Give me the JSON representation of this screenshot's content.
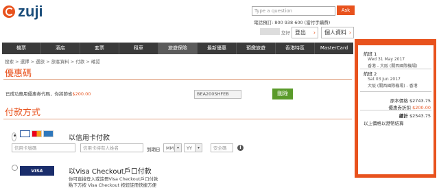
{
  "brand": {
    "name": "zuji",
    "accent": "#e8521d",
    "logo_color": "#1a4d7a"
  },
  "header": {
    "search_placeholder": "Type a question",
    "ask_label": "Ask",
    "phone": "電話預訂: 800 938 600 (當付手續費)",
    "account_time": "您好",
    "logout_label": "登出",
    "profile_label": "個人資料"
  },
  "nav": {
    "items": [
      "機票",
      "酒店",
      "套票",
      "租車",
      "旅遊保險",
      "最新優惠",
      "預繳旅遊",
      "香港特區",
      "MasterCard"
    ]
  },
  "breadcrumb": "搜索 > 選擇 > 選旅 > 旅客資料 > 付款 > 確認",
  "promo": {
    "title": "優惠碼",
    "text": "已成功應用優惠券代碼，你將節省",
    "amount": "$200.00",
    "code": "BEA200SHFEB",
    "delete_label": "刪除"
  },
  "payment": {
    "title": "付款方式",
    "cc_label": "以信用卡付款",
    "card_number_placeholder": "信用卡號碼",
    "card_holder_placeholder": "信用卡持有人姓名",
    "expiry_label": "到期日",
    "month_placeholder": "MM",
    "year_placeholder": "YY",
    "cvv_placeholder": "安全碼",
    "visa_checkout_badge": "VISA Checkout",
    "vc_label": "以Visa Checkout戶口付款",
    "vc_desc1": "你可直接登入或註冊Visa Checkout戶口付款",
    "vc_desc2": "點下方按 Visa Checkout 按鈕註冊快捷方便"
  },
  "trip": {
    "leg1_title": "航班 1",
    "leg1_date": "Wed 31 May 2017",
    "leg1_route": "香港 - 大阪 (關西國際機場)",
    "leg2_title": "航班 2",
    "leg2_date": "Sat 03 Jun 2017",
    "leg2_route": "大阪 (關西國際機場) - 香港"
  },
  "summary": {
    "original_label": "原本價格",
    "original_value": "$2743.75",
    "discount_label": "優惠券折扣",
    "discount_value": "$200.00",
    "total_label": "總計",
    "total_value": "$2543.75",
    "note": "以上價格以港幣結算"
  }
}
